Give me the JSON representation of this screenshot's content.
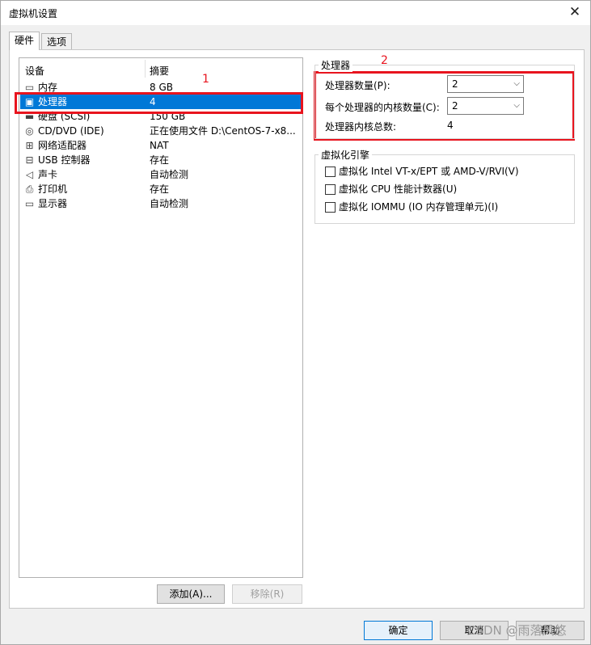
{
  "window": {
    "title": "虚拟机设置",
    "close_glyph": "✕"
  },
  "tabs": [
    {
      "label": "硬件"
    },
    {
      "label": "选项"
    }
  ],
  "device_list": {
    "headers": {
      "device": "设备",
      "summary": "摘要"
    },
    "rows": [
      {
        "name": "内存",
        "summary": "8 GB",
        "icon": "memory-icon",
        "glyph": "▭"
      },
      {
        "name": "处理器",
        "summary": "4",
        "icon": "processor-icon",
        "glyph": "▣"
      },
      {
        "name": "硬盘 (SCSI)",
        "summary": "150 GB",
        "icon": "hard-disk-icon",
        "glyph": "▬"
      },
      {
        "name": "CD/DVD (IDE)",
        "summary": "正在使用文件 D:\\CentOS-7-x8...",
        "icon": "cd-dvd-icon",
        "glyph": "◎"
      },
      {
        "name": "网络适配器",
        "summary": "NAT",
        "icon": "network-adapter-icon",
        "glyph": "⊞"
      },
      {
        "name": "USB 控制器",
        "summary": "存在",
        "icon": "usb-icon",
        "glyph": "⊟"
      },
      {
        "name": "声卡",
        "summary": "自动检测",
        "icon": "speaker-icon",
        "glyph": "◁"
      },
      {
        "name": "打印机",
        "summary": "存在",
        "icon": "printer-icon",
        "glyph": "⎙"
      },
      {
        "name": "显示器",
        "summary": "自动检测",
        "icon": "monitor-icon",
        "glyph": "▭"
      }
    ],
    "selected_index": 1
  },
  "buttons": {
    "add": "添加(A)...",
    "remove": "移除(R)",
    "ok": "确定",
    "cancel": "取消",
    "help": "帮助"
  },
  "processor_group": {
    "legend": "处理器",
    "count_label": "处理器数量(P):",
    "count_value": "2",
    "cores_label": "每个处理器的内核数量(C):",
    "cores_value": "2",
    "total_label": "处理器内核总数:",
    "total_value": "4"
  },
  "virtualization_group": {
    "legend": "虚拟化引擎",
    "options": [
      {
        "label": "虚拟化 Intel VT-x/EPT 或 AMD-V/RVI(V)",
        "checked": false
      },
      {
        "label": "虚拟化 CPU 性能计数器(U)",
        "checked": false
      },
      {
        "label": "虚拟化 IOMMU (IO 内存管理单元)(I)",
        "checked": false
      }
    ]
  },
  "annotations": {
    "one": "1",
    "two": "2"
  },
  "watermark": "CSDN @雨落风悠",
  "colors": {
    "selection": "#0078d7",
    "annotation_red": "#e8141e"
  }
}
